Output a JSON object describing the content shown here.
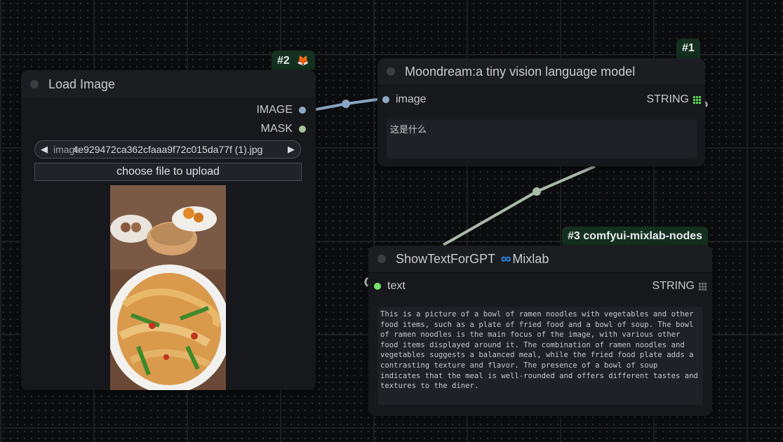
{
  "colors": {
    "image_port": "#8ea9c7",
    "mask_port": "#a8c59a",
    "text_port": "#7de36f",
    "string_green": "#5fd35a",
    "string_grey": "#6d7175",
    "link_image": "#8aa4c2",
    "link_string": "#a9baa8",
    "mixlab_blue": "#2f8ff7"
  },
  "nodes": {
    "load_image": {
      "badge": "#2",
      "badge_icon": "fox-icon",
      "badge_emoji": "🦊",
      "title": "Load Image",
      "outputs": [
        "IMAGE",
        "MASK"
      ],
      "filename": "4e929472ca362cfaaa9f72c015da77f (1).jpg",
      "combo_label": "image",
      "upload_label": "choose file to upload",
      "preview": "noodle-dish-photo"
    },
    "moondream": {
      "badge": "#1",
      "title": "Moondream:a tiny vision language model",
      "input": "image",
      "output": "STRING",
      "prompt": "这是什么"
    },
    "show_text": {
      "badge": "#3 comfyui-mixlab-nodes",
      "title": "ShowTextForGPT",
      "brand_icon": "infinity-icon",
      "brand": "Mixlab",
      "input": "text",
      "output": "STRING",
      "content": "This is a picture of a bowl of ramen noodles with vegetables and other food items, such as a plate of fried food and a bowl of soup. The bowl of ramen noodles is the main focus of the image, with various other food items displayed around it. The combination of ramen noodles and vegetables suggests a balanced meal, while the fried food plate adds a contrasting texture and flavor. The presence of a bowl of soup indicates that the meal is well-rounded and offers different tastes and textures to the diner."
    }
  }
}
